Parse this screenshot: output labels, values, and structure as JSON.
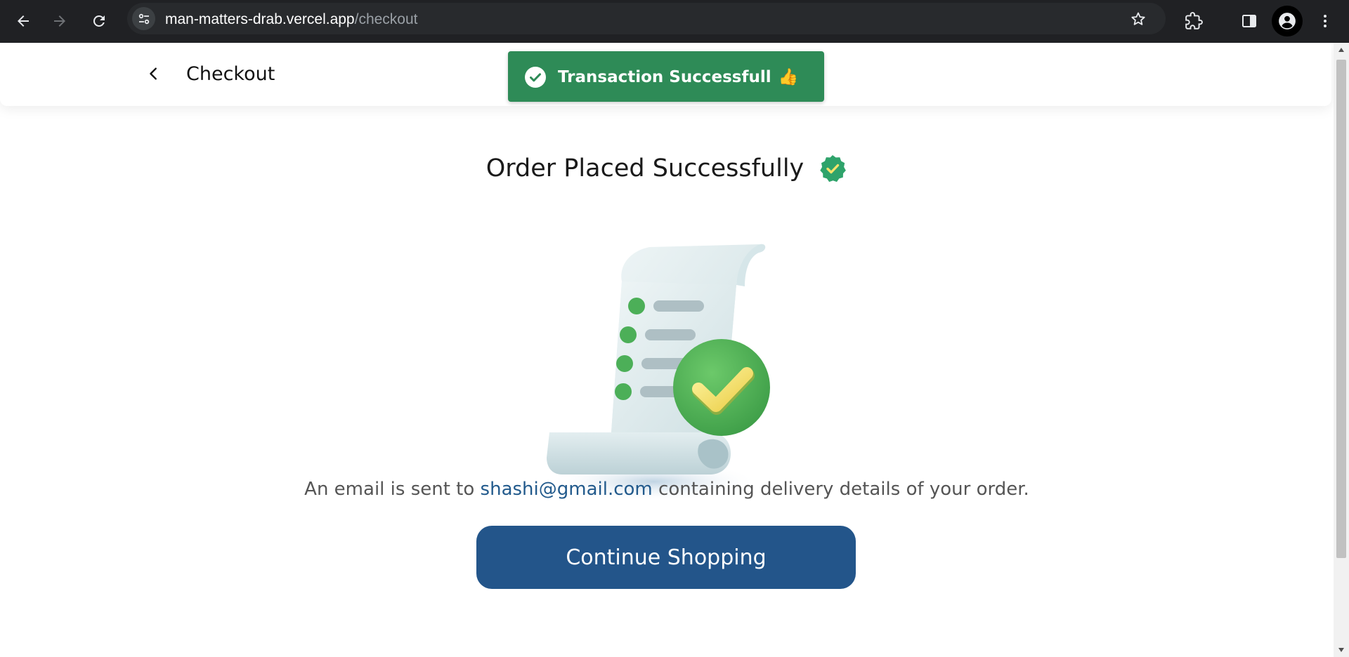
{
  "browser": {
    "url_host": "man-matters-drab.vercel.app",
    "url_path": "/checkout",
    "icons": {
      "back": "arrow-left-icon",
      "forward": "arrow-right-icon",
      "reload": "reload-icon",
      "site_info": "tune-icon",
      "bookmark": "star-icon",
      "extensions": "puzzle-icon",
      "side_panel": "side-panel-icon",
      "profile": "person-icon",
      "menu": "more-vert-icon"
    }
  },
  "header": {
    "title": "Checkout",
    "back_icon": "chevron-left-icon"
  },
  "toast": {
    "message": "Transaction Successfull",
    "emoji": "👍",
    "icon": "check-circle-icon",
    "color": "#2e8b57"
  },
  "main": {
    "heading": "Order Placed Successfully",
    "verified_icon": "verified-badge-icon",
    "illustration": "receipt-check-illustration",
    "email_prefix": "An email is sent to",
    "email": "shashi@gmail.com",
    "email_suffix": "containing delivery details of your order.",
    "continue_label": "Continue Shopping",
    "button_color": "#23558a"
  }
}
